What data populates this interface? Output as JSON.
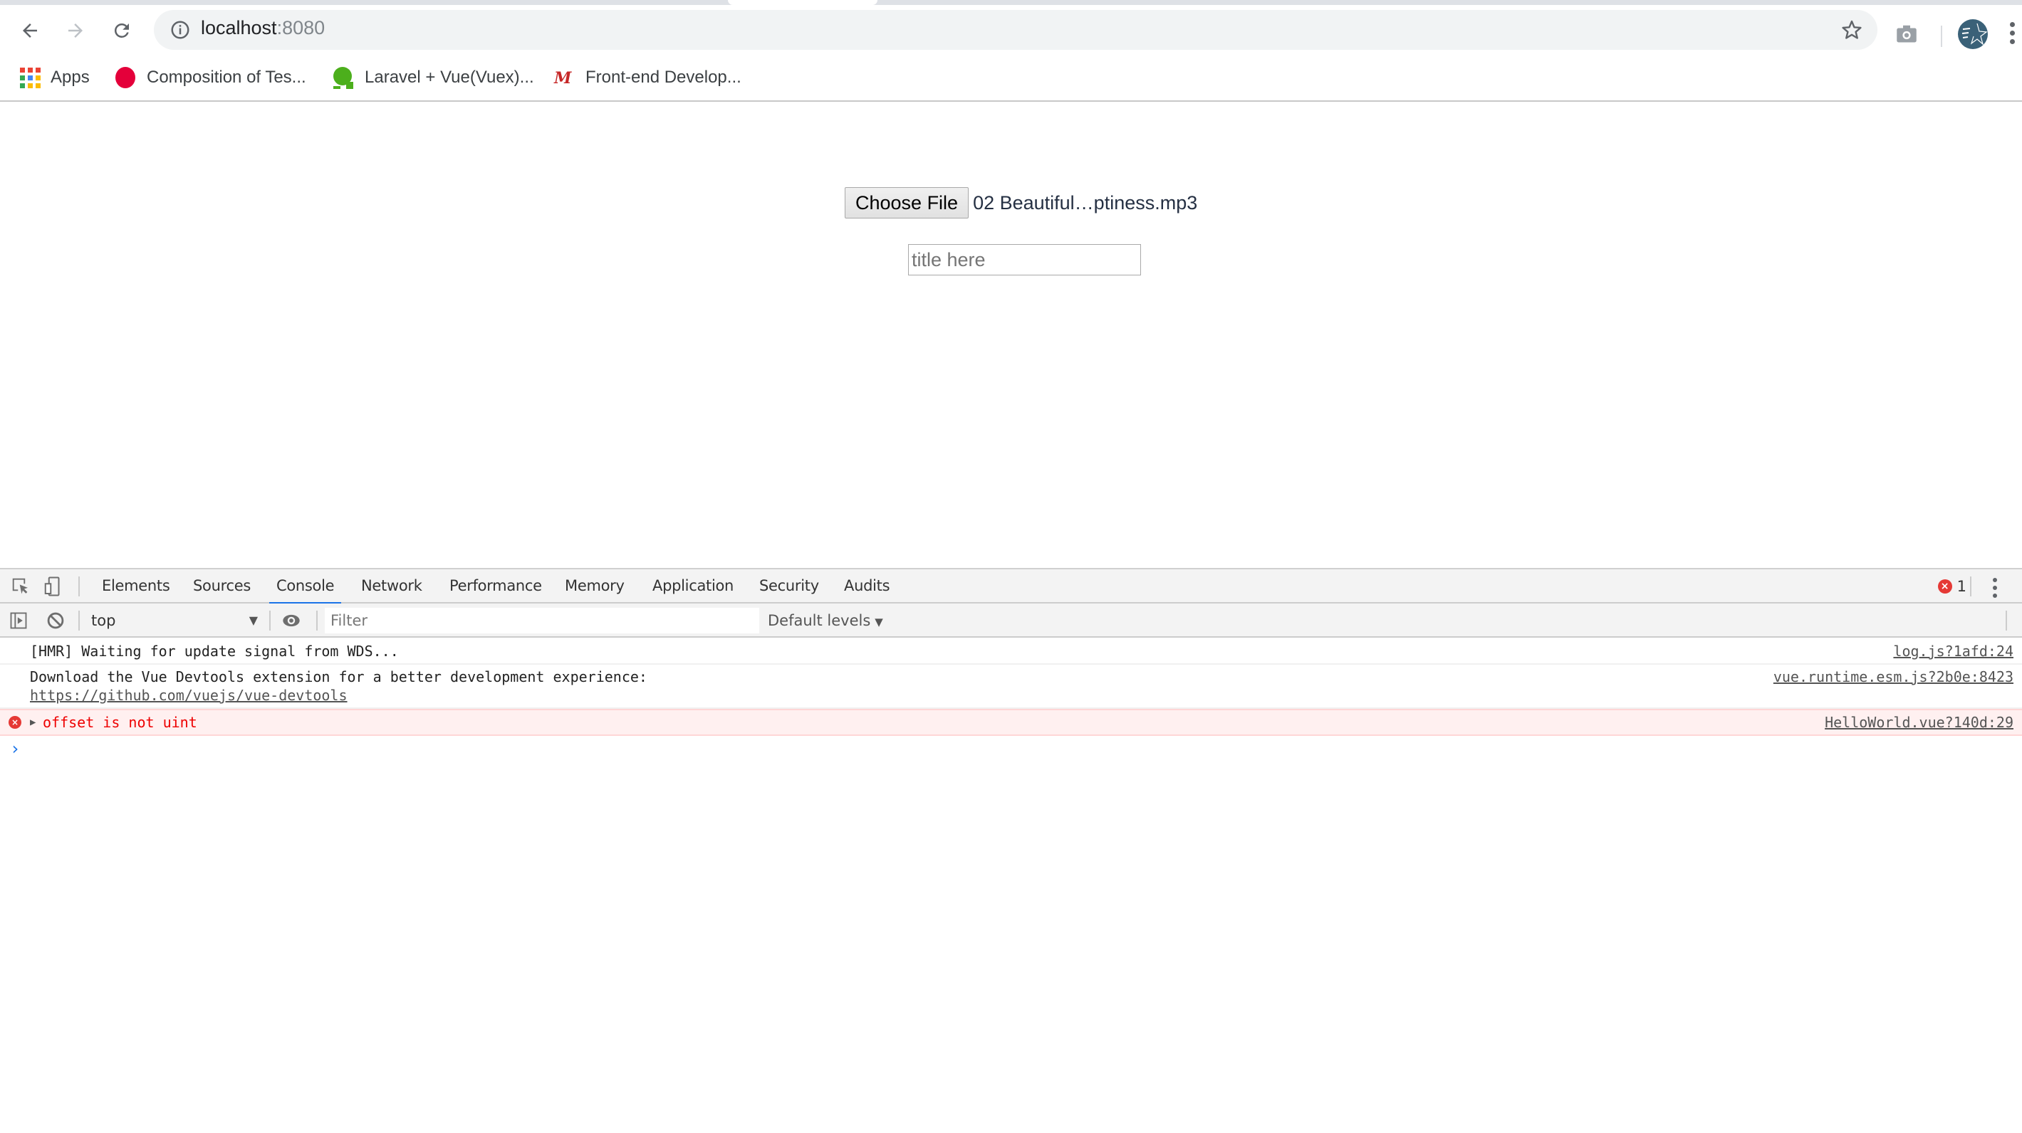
{
  "browser": {
    "url_host": "localhost",
    "url_port": ":8080",
    "bookmarks": [
      {
        "label": "Apps",
        "icon": "apps-grid-icon"
      },
      {
        "label": "Composition of Tes...",
        "icon": "red-circle-favicon"
      },
      {
        "label": "Laravel + Vue(Vuex)...",
        "icon": "green-q-favicon"
      },
      {
        "label": "Front-end Develop...",
        "icon": "red-m-favicon"
      }
    ]
  },
  "page": {
    "choose_file_label": "Choose File",
    "file_name": "02 Beautiful…ptiness.mp3",
    "title_input": {
      "value": "",
      "placeholder": "title here"
    }
  },
  "devtools": {
    "tabs": [
      "Elements",
      "Sources",
      "Console",
      "Network",
      "Performance",
      "Memory",
      "Application",
      "Security",
      "Audits"
    ],
    "active_tab": "Console",
    "error_count": "1",
    "context": "top",
    "filter_placeholder": "Filter",
    "levels_label": "Default levels",
    "messages": [
      {
        "level": "info",
        "text": "[HMR] Waiting for update signal from WDS...",
        "source": "log.js?1afd:24"
      },
      {
        "level": "info",
        "text": "Download the Vue Devtools extension for a better development experience:",
        "link": "https://github.com/vuejs/vue-devtools",
        "source": "vue.runtime.esm.js?2b0e:8423"
      },
      {
        "level": "error",
        "text": "offset is not uint",
        "source": "HelloWorld.vue?140d:29"
      }
    ],
    "prompt_symbol": "›"
  },
  "colors": {
    "accent": "#1a73e8",
    "error": "#e53935",
    "error_bg": "#fff0f0",
    "avatar": "#3a6178"
  }
}
